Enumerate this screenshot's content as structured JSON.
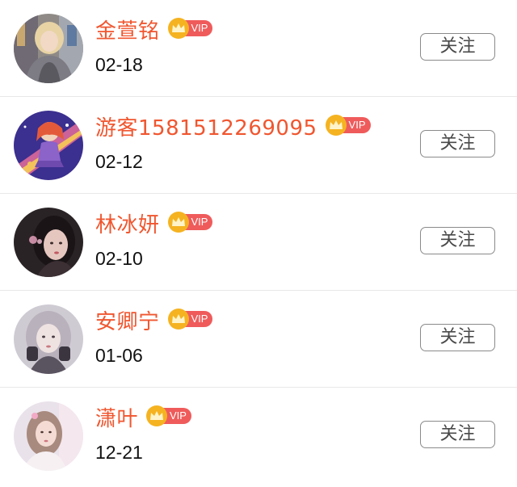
{
  "users": [
    {
      "name": "金萱铭",
      "date": "02-18",
      "vip_label": "VIP",
      "follow_label": "关注",
      "avatar_icon": "avatar-photo-girl-blonde"
    },
    {
      "name": "游客1581512269095",
      "date": "02-12",
      "vip_label": "VIP",
      "follow_label": "关注",
      "avatar_icon": "avatar-illustration-girl-purple"
    },
    {
      "name": "林冰妍",
      "date": "02-10",
      "vip_label": "VIP",
      "follow_label": "关注",
      "avatar_icon": "avatar-photo-girl-dark"
    },
    {
      "name": "安卿宁",
      "date": "01-06",
      "vip_label": "VIP",
      "follow_label": "关注",
      "avatar_icon": "avatar-photo-girl-grey"
    },
    {
      "name": "潇叶",
      "date": "12-21",
      "vip_label": "VIP",
      "follow_label": "关注",
      "avatar_icon": "avatar-photo-girl-pink"
    }
  ],
  "colors": {
    "name": "#f0562f",
    "vip_crown": "#f5b321",
    "vip_pill": "#ef5b5b",
    "button_border": "#8a8a8a",
    "divider": "#e8e8e8"
  }
}
